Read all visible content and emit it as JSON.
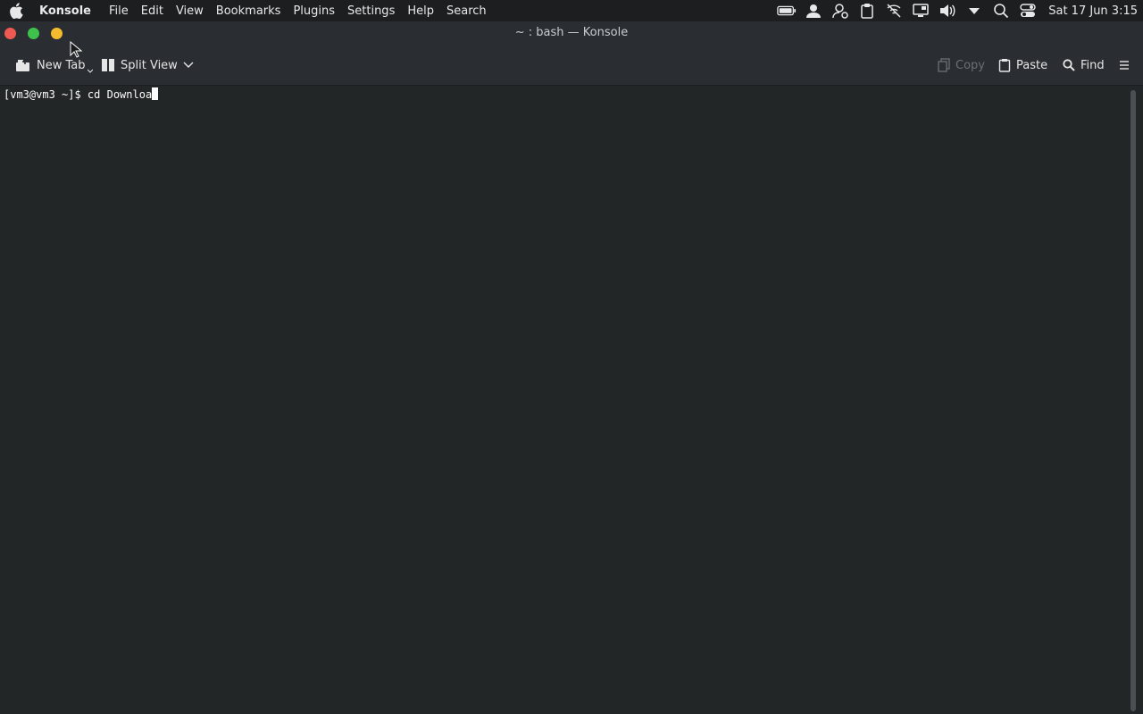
{
  "menubar": {
    "app_name": "Konsole",
    "items": [
      "File",
      "Edit",
      "View",
      "Bookmarks",
      "Plugins",
      "Settings",
      "Help",
      "Search"
    ],
    "clock": "Sat 17 Jun 3:15",
    "tray_icons": [
      "battery-icon",
      "user-icon",
      "user-settings-icon",
      "clipboard-icon",
      "network-muted-icon",
      "display-icon",
      "volume-icon",
      "tray-expand-icon",
      "search-icon",
      "toggle-settings-icon"
    ]
  },
  "window": {
    "title": "~ : bash — Konsole"
  },
  "toolbar": {
    "new_tab_label": "New Tab",
    "split_view_label": "Split View",
    "copy_label": "Copy",
    "paste_label": "Paste",
    "find_label": "Find"
  },
  "terminal": {
    "prompt": "[vm3@vm3 ~]$ ",
    "input": "cd Downloa"
  },
  "colors": {
    "terminal_bg": "#232627",
    "toolbar_bg": "#2a2e32",
    "menubar_bg": "#1c1e20",
    "close": "#ee5a52",
    "maximize": "#3fc24c",
    "minimize": "#f3bb2d"
  }
}
